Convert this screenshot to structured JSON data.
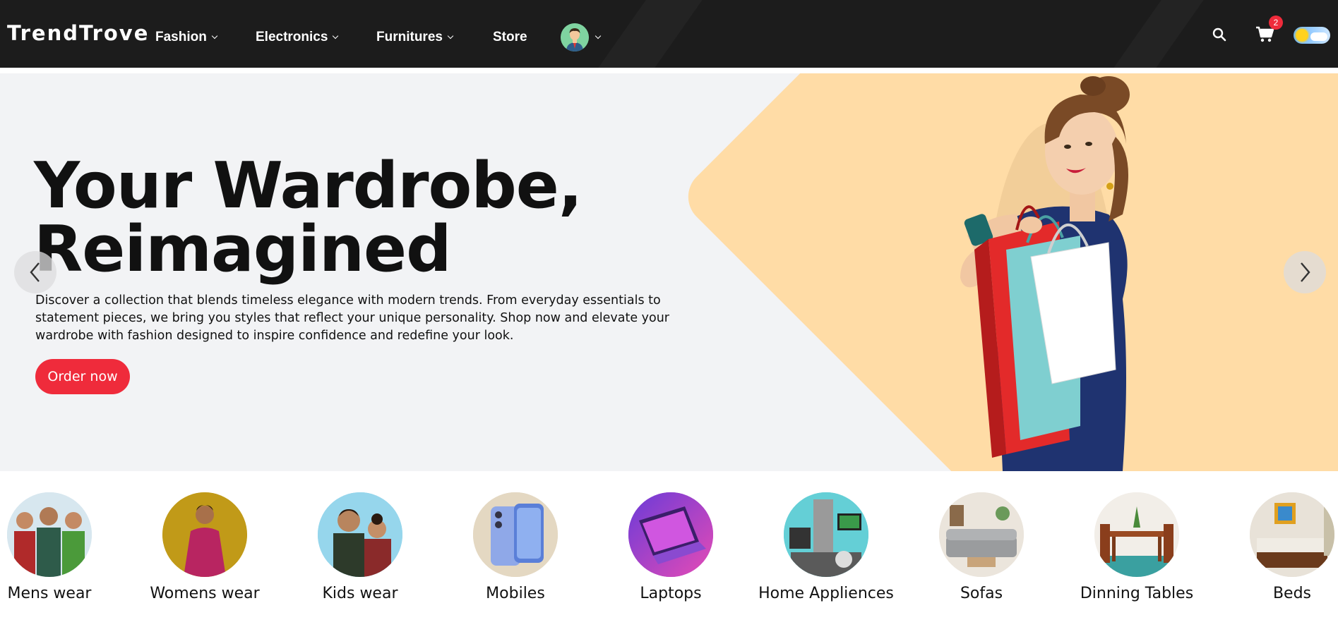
{
  "brand": "TrendTrove",
  "nav": {
    "items": [
      {
        "label": "Fashion",
        "dropdown": true
      },
      {
        "label": "Electronics",
        "dropdown": true
      },
      {
        "label": "Furnitures",
        "dropdown": true
      },
      {
        "label": "Store",
        "dropdown": false
      }
    ],
    "cart_count": "2",
    "icons": [
      "user-avatar-icon",
      "search-icon",
      "cart-icon",
      "theme-toggle-icon"
    ]
  },
  "hero": {
    "title_line1": "Your Wardrobe,",
    "title_line2": "Reimagined",
    "description": "Discover a collection that blends timeless elegance with modern trends. From everyday essentials to statement pieces, we bring you styles that reflect your unique personality. Shop now and elevate your wardrobe with fashion designed to inspire confidence and redefine your look.",
    "cta": "Order now"
  },
  "categories": [
    {
      "label": "Mens wear"
    },
    {
      "label": "Womens wear"
    },
    {
      "label": "Kids wear"
    },
    {
      "label": "Mobiles"
    },
    {
      "label": "Laptops"
    },
    {
      "label": "Home Appliences"
    },
    {
      "label": "Sofas"
    },
    {
      "label": "Dinning Tables"
    },
    {
      "label": "Beds"
    }
  ],
  "colors": {
    "nav_bg": "#1c1c1c",
    "accent": "#ef2b3b",
    "hero_bg": "#f2f3f5",
    "hero_shape": "#ffdca6"
  }
}
